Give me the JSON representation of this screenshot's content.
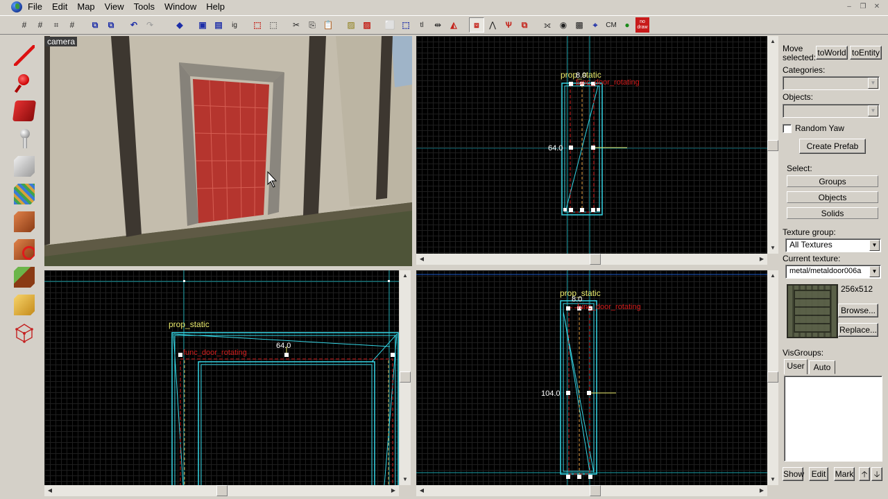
{
  "menu": [
    "File",
    "Edit",
    "Map",
    "View",
    "Tools",
    "Window",
    "Help"
  ],
  "window_controls": [
    "–",
    "❐",
    "✕"
  ],
  "toolbar_icons": [
    "grid-toggle-icon",
    "grid-3d-icon",
    "grid-dot-icon",
    "grid-size-icon",
    "group-icon",
    "ungroup-icon",
    "undo-icon",
    "redo-icon",
    "carve-icon",
    "hollow-icon",
    "selection-icon",
    "face-edit-icon",
    "ignore-groups-icon",
    "copy-icon",
    "paste-icon",
    "cut-icon",
    "paste-special-icon",
    "texture-lock-icon",
    "texture-app-icon",
    "tie-to-entity-icon",
    "move-to-world-icon",
    "flip-horizontal-icon",
    "flip-vertical-icon",
    "align-icon",
    "check-problems-icon",
    "run-map-icon",
    "cordon-icon",
    "toggle-models-icon",
    "radar-icon",
    "camera-icon",
    "display-icon",
    "helpers-icon",
    "cm-icon",
    "skybox-icon",
    "nodraw-icon"
  ],
  "toolbar_texts": {
    "ig": "ig",
    "tl": "tl",
    "cm": "CM",
    "nodraw": "no draw"
  },
  "tools": [
    "selection-tool-icon",
    "magnify-tool-icon",
    "camera-tool-icon",
    "entity-tool-icon",
    "block-tool-icon",
    "texture-application-icon",
    "apply-current-texture-icon",
    "apply-decal-icon",
    "apply-overlay-icon",
    "clipping-tool-icon",
    "vertex-tool-icon"
  ],
  "viewports": {
    "camera": {
      "label": "camera"
    },
    "top": {
      "prop_label": "prop_static",
      "func_label": "func_door_rotating",
      "width_value": "8.0",
      "height_value": "64.0"
    },
    "front": {
      "prop_label": "prop_static",
      "func_label": "func_door_rotating",
      "width_value": "64.0"
    },
    "side": {
      "prop_label": "prop_static",
      "func_label": "func_door_rotating",
      "width_value": "8.0",
      "height_value": "104.0"
    }
  },
  "panel": {
    "move_selected": "Move selected:",
    "to_world": "toWorld",
    "to_entity": "toEntity",
    "categories_label": "Categories:",
    "categories_value": "",
    "objects_label": "Objects:",
    "objects_value": "",
    "random_yaw": "Random Yaw",
    "create_prefab": "Create Prefab",
    "select_label": "Select:",
    "groups": "Groups",
    "objects": "Objects",
    "solids": "Solids",
    "texture_group_label": "Texture group:",
    "texture_group_value": "All Textures",
    "current_texture_label": "Current texture:",
    "current_texture_value": "metal/metaldoor006a",
    "texture_size": "256x512",
    "browse": "Browse...",
    "replace": "Replace...",
    "visgroups_label": "VisGroups:",
    "tab_user": "User",
    "tab_auto": "Auto",
    "show": "Show",
    "edit": "Edit",
    "mark": "Mark",
    "arrow_up": "🡡",
    "arrow_down": "🡣"
  },
  "colors": {
    "grid_bg": "#000000",
    "brush_cyan": "#35d8e8",
    "entity_red": "#d21d1d",
    "label_yellow": "#e8e86a",
    "door_red": "#b5352e"
  }
}
